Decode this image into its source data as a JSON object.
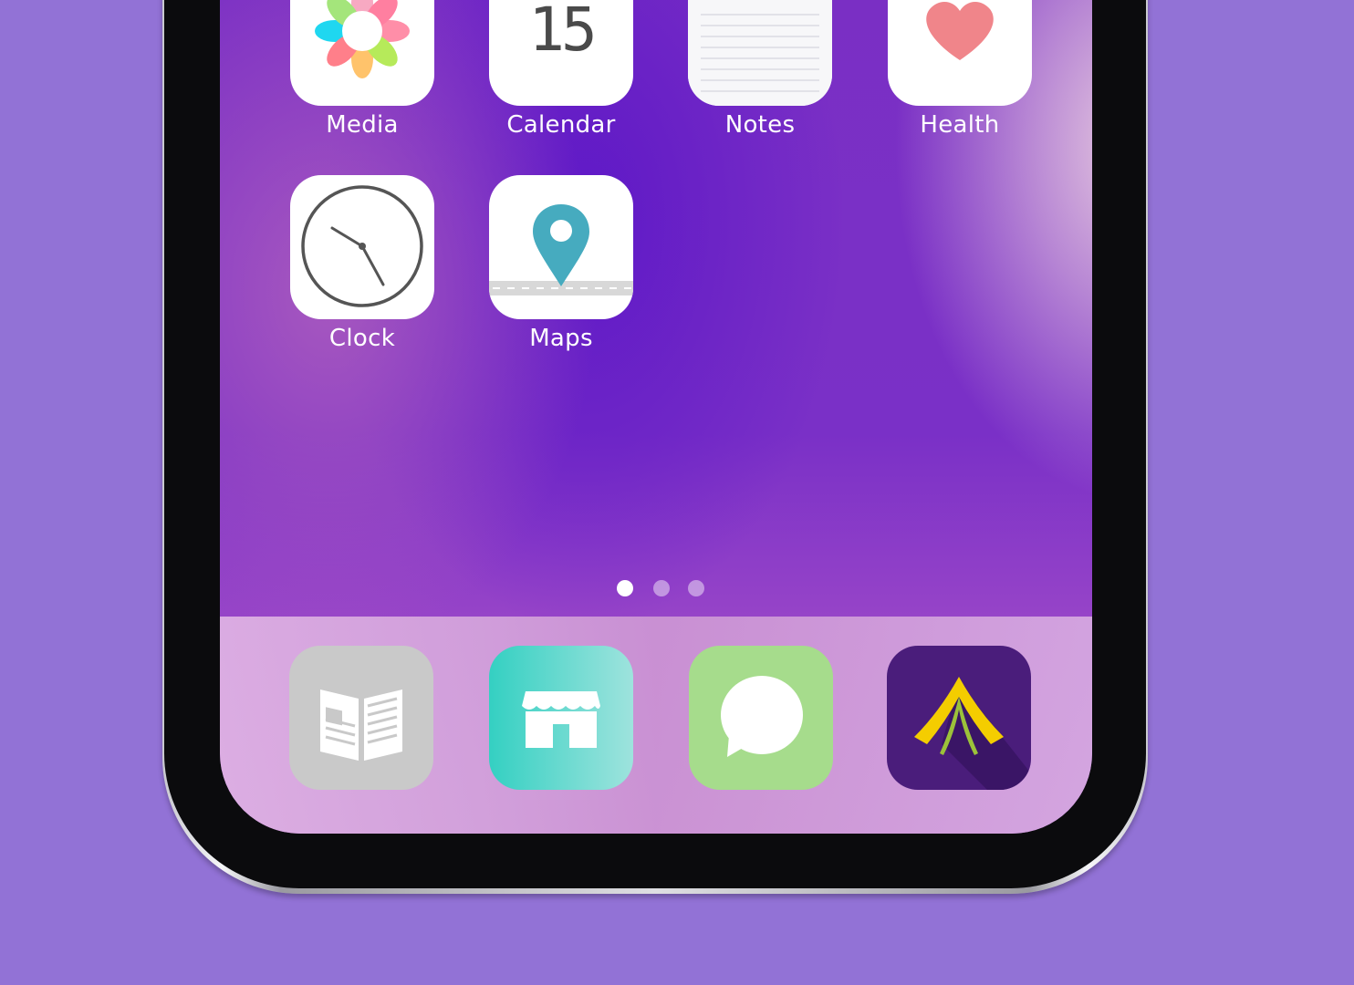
{
  "home_screen": {
    "apps": [
      {
        "label": "Media",
        "icon": "media-flower-icon"
      },
      {
        "label": "Calendar",
        "icon": "calendar-icon",
        "day": "15"
      },
      {
        "label": "Notes",
        "icon": "notes-icon"
      },
      {
        "label": "Health",
        "icon": "heart-icon"
      },
      {
        "label": "Clock",
        "icon": "clock-icon"
      },
      {
        "label": "Maps",
        "icon": "map-pin-icon"
      }
    ],
    "page_indicator": {
      "pages": 3,
      "current": 1
    }
  },
  "dock": {
    "apps": [
      {
        "icon": "news-icon"
      },
      {
        "icon": "store-icon"
      },
      {
        "icon": "message-icon"
      },
      {
        "icon": "tent-icon"
      }
    ]
  },
  "colors": {
    "background": "#9272d6",
    "heart": "#f0858a",
    "map_pin": "#46abbf",
    "store_start": "#34d0c2",
    "store_end": "#9ee3dd",
    "messages": "#a6dc8c",
    "tent_bg": "#4a1d7b",
    "tent_yellow": "#f4cd00",
    "news": "#c9c9c9"
  }
}
